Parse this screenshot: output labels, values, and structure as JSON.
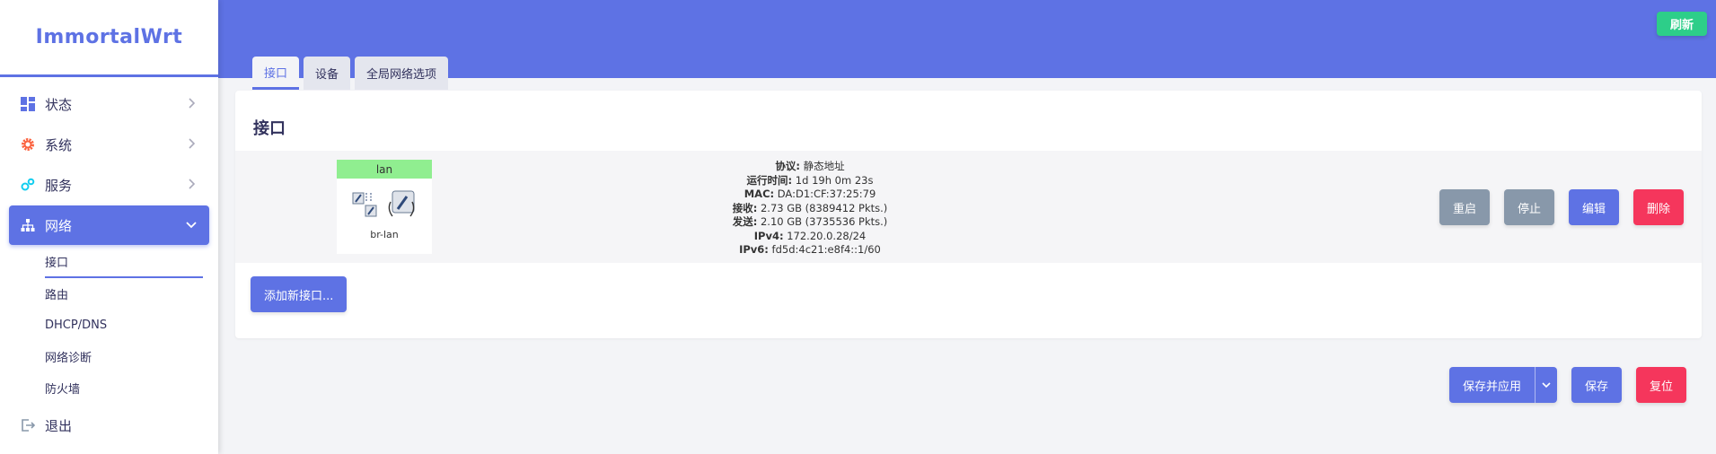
{
  "brand": {
    "name": "ImmortalWrt",
    "color": "#5e72e4"
  },
  "sidebar": {
    "items": [
      {
        "label": "状态",
        "icon": "dashboard-icon"
      },
      {
        "label": "系统",
        "icon": "gear-icon"
      },
      {
        "label": "服务",
        "icon": "cogs-icon"
      },
      {
        "label": "网络",
        "icon": "network-icon",
        "active": true
      }
    ],
    "network_sub": [
      {
        "label": "接口",
        "active": true
      },
      {
        "label": "路由"
      },
      {
        "label": "DHCP/DNS"
      },
      {
        "label": "网络诊断"
      },
      {
        "label": "防火墙"
      }
    ],
    "logout": {
      "label": "退出",
      "icon": "logout-icon"
    }
  },
  "header": {
    "refresh_label": "刷新"
  },
  "tabs": [
    {
      "label": "接口",
      "active": true
    },
    {
      "label": "设备"
    },
    {
      "label": "全局网络选项"
    }
  ],
  "card": {
    "title": "接口",
    "interface": {
      "name": "lan",
      "device": "br-lan",
      "info": [
        {
          "key": "协议:",
          "value": " 静态地址"
        },
        {
          "key": "运行时间:",
          "value": " 1d 19h 0m 23s"
        },
        {
          "key": "MAC:",
          "value": " DA:D1:CF:37:25:79"
        },
        {
          "key": "接收:",
          "value": " 2.73 GB (8389412 Pkts.)"
        },
        {
          "key": "发送:",
          "value": " 2.10 GB (3735536 Pkts.)"
        },
        {
          "key": "IPv4:",
          "value": " 172.20.0.28/24"
        },
        {
          "key": "IPv6:",
          "value": " fd5d:4c21:e8f4::1/60"
        }
      ],
      "actions": {
        "restart": "重启",
        "stop": "停止",
        "edit": "编辑",
        "delete": "删除"
      }
    },
    "add_label": "添加新接口..."
  },
  "footer": {
    "save_apply": "保存并应用",
    "save": "保存",
    "reset": "复位"
  },
  "colors": {
    "primary": "#5e72e4",
    "success": "#2dce89",
    "danger": "#f5365c",
    "secondary": "#8898aa",
    "iface_tag": "#90ee90"
  }
}
